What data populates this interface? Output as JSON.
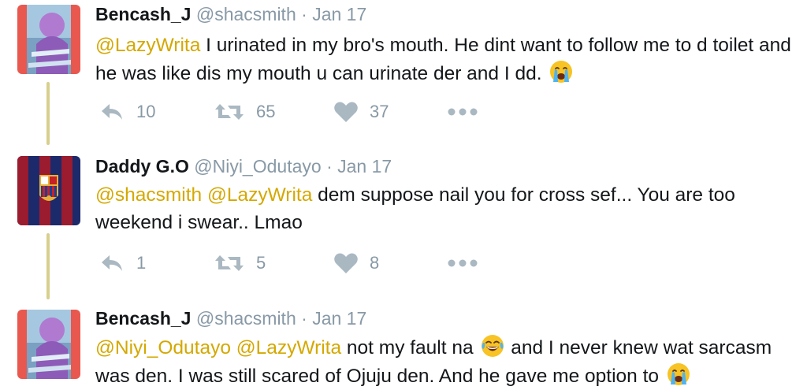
{
  "tweets": [
    {
      "name": "Bencash_J",
      "handle": "@shacsmith",
      "separator": "·",
      "date": "Jan 17",
      "mention_1": "@LazyWrita",
      "text_1": " I urinated in my bro's mouth. He dint want to follow me to d toilet and he was like dis my mouth u can urinate der and I dd. ",
      "emoji_1": "crying-face-icon",
      "reply_count": "10",
      "retweet_count": "65",
      "like_count": "37"
    },
    {
      "name": "Daddy G.O",
      "handle": "@Niyi_Odutayo",
      "separator": "·",
      "date": "Jan 17",
      "mention_1": "@shacsmith",
      "mention_2": "@LazyWrita",
      "text_1": " dem suppose nail you for cross sef... You are too weekend i swear.. Lmao",
      "reply_count": "1",
      "retweet_count": "5",
      "like_count": "8"
    },
    {
      "name": "Bencash_J",
      "handle": "@shacsmith",
      "separator": "·",
      "date": "Jan 17",
      "mention_1": "@Niyi_Odutayo",
      "mention_2": "@LazyWrita",
      "text_1": " not my fault na ",
      "emoji_1": "tears-of-joy-icon",
      "text_2": " and I never knew wat sarcasm was den. I was still scared of Ojuju den. And he gave me option to ",
      "emoji_2": "crying-face-icon"
    }
  ],
  "colors": {
    "mention": "#d4a800",
    "muted": "#8899a6",
    "thread_line": "#d8cf8e",
    "text": "#14171a"
  }
}
